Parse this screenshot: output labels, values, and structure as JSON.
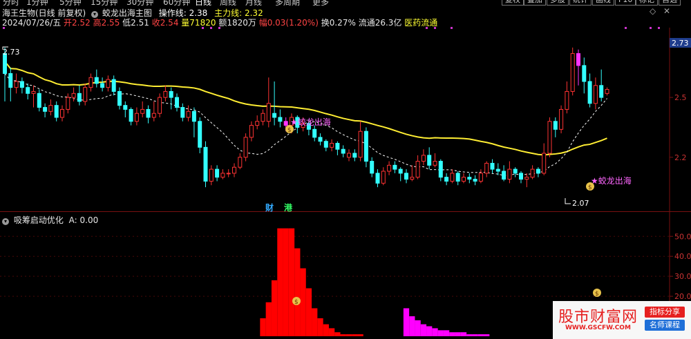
{
  "toolbar": {
    "periods": [
      "分时",
      "1分钟",
      "5分钟",
      "15分钟",
      "30分钟",
      "60分钟",
      "日线",
      "周线",
      "月线",
      "多周期",
      "更多"
    ],
    "active_period": "日线",
    "right_tabs": [
      "复权",
      "叠加",
      "多股",
      "统计",
      "画线",
      "F10",
      "标记",
      "自选"
    ],
    "diamond": "◇",
    "close": "✕"
  },
  "header": {
    "stock": "海王生物(日线 前复权)",
    "chart_name": "蛟龙出海主图",
    "op_label": "操作线:",
    "op_value": "2.38",
    "main_label": "主力线:",
    "main_value": "2.32"
  },
  "quote": {
    "date": "2024/07/26/五",
    "open": "开2.52",
    "high": "高2.55",
    "low": "低2.51",
    "close": "收2.54",
    "volume": "量71820",
    "amount": "额1820万",
    "change": "幅0.03(1.20%)",
    "turnover": "换0.27%",
    "float_cap": "流通26.3亿",
    "sector": "医药流通"
  },
  "indicator": {
    "name": "吸筹启动优化",
    "value": "A: 0.00"
  },
  "chart_data": [
    {
      "type": "candlestick",
      "name": "main",
      "current_price_tag": "2.73",
      "y_ticks": [
        2.5,
        2.2
      ],
      "ylim": [
        1.95,
        2.85
      ],
      "candles": [
        [
          2.62,
          2.72,
          2.75,
          2.48
        ],
        [
          2.55,
          2.62,
          2.65,
          2.48
        ],
        [
          2.58,
          2.55,
          2.62,
          2.52
        ],
        [
          2.55,
          2.58,
          2.6,
          2.52
        ],
        [
          2.52,
          2.55,
          2.57,
          2.49
        ],
        [
          2.53,
          2.52,
          2.56,
          2.45
        ],
        [
          2.45,
          2.52,
          2.54,
          2.43
        ],
        [
          2.43,
          2.45,
          2.47,
          2.4
        ],
        [
          2.46,
          2.43,
          2.49,
          2.41
        ],
        [
          2.4,
          2.46,
          2.48,
          2.38
        ],
        [
          2.44,
          2.4,
          2.46,
          2.38
        ],
        [
          2.5,
          2.44,
          2.52,
          2.42
        ],
        [
          2.52,
          2.5,
          2.55,
          2.48
        ],
        [
          2.48,
          2.52,
          2.56,
          2.46
        ],
        [
          2.55,
          2.48,
          2.57,
          2.46
        ],
        [
          2.6,
          2.55,
          2.62,
          2.53
        ],
        [
          2.57,
          2.6,
          2.64,
          2.55
        ],
        [
          2.55,
          2.57,
          2.6,
          2.53
        ],
        [
          2.59,
          2.55,
          2.61,
          2.53
        ],
        [
          2.53,
          2.59,
          2.61,
          2.51
        ],
        [
          2.46,
          2.53,
          2.55,
          2.44
        ],
        [
          2.44,
          2.46,
          2.48,
          2.4
        ],
        [
          2.38,
          2.44,
          2.45,
          2.36
        ],
        [
          2.42,
          2.38,
          2.45,
          2.36
        ],
        [
          2.44,
          2.42,
          2.48,
          2.4
        ],
        [
          2.4,
          2.44,
          2.46,
          2.37
        ],
        [
          2.42,
          2.4,
          2.48,
          2.38
        ],
        [
          2.5,
          2.42,
          2.52,
          2.4
        ],
        [
          2.53,
          2.5,
          2.56,
          2.48
        ],
        [
          2.5,
          2.53,
          2.55,
          2.44
        ],
        [
          2.45,
          2.5,
          2.52,
          2.43
        ],
        [
          2.4,
          2.45,
          2.47,
          2.38
        ],
        [
          2.43,
          2.4,
          2.46,
          2.38
        ],
        [
          2.38,
          2.43,
          2.45,
          2.3
        ],
        [
          2.25,
          2.38,
          2.4,
          2.22
        ],
        [
          2.08,
          2.25,
          2.28,
          2.05
        ],
        [
          2.14,
          2.08,
          2.16,
          2.06
        ],
        [
          2.1,
          2.14,
          2.16,
          2.08
        ],
        [
          2.12,
          2.1,
          2.14,
          2.09
        ],
        [
          2.12,
          2.12,
          2.14,
          2.1
        ],
        [
          2.15,
          2.12,
          2.17,
          2.1
        ],
        [
          2.2,
          2.15,
          2.22,
          2.14
        ],
        [
          2.3,
          2.2,
          2.32,
          2.18
        ],
        [
          2.36,
          2.3,
          2.38,
          2.28
        ],
        [
          2.38,
          2.36,
          2.41,
          2.34
        ],
        [
          2.42,
          2.38,
          2.44,
          2.36
        ],
        [
          2.47,
          2.38,
          2.6,
          2.35
        ],
        [
          2.4,
          2.42,
          2.58,
          2.36
        ],
        [
          2.38,
          2.4,
          2.44,
          2.35
        ],
        [
          2.36,
          2.38,
          2.4,
          2.33
        ],
        [
          2.4,
          2.36,
          2.42,
          2.32
        ],
        [
          2.35,
          2.4,
          2.41,
          2.32
        ],
        [
          2.37,
          2.35,
          2.4,
          2.33
        ],
        [
          2.34,
          2.37,
          2.39,
          2.31
        ],
        [
          2.3,
          2.34,
          2.36,
          2.28
        ],
        [
          2.28,
          2.3,
          2.32,
          2.26
        ],
        [
          2.25,
          2.28,
          2.29,
          2.23
        ],
        [
          2.27,
          2.25,
          2.29,
          2.23
        ],
        [
          2.24,
          2.27,
          2.28,
          2.21
        ],
        [
          2.22,
          2.24,
          2.26,
          2.2
        ],
        [
          2.22,
          2.2,
          2.24,
          2.18
        ],
        [
          2.2,
          2.22,
          2.24,
          2.18
        ],
        [
          2.33,
          2.2,
          2.38,
          2.18
        ],
        [
          2.18,
          2.33,
          2.35,
          2.15
        ],
        [
          2.12,
          2.18,
          2.2,
          2.1
        ],
        [
          2.07,
          2.12,
          2.14,
          2.05
        ],
        [
          2.13,
          2.07,
          2.15,
          2.06
        ],
        [
          2.16,
          2.13,
          2.18,
          2.11
        ],
        [
          2.14,
          2.16,
          2.18,
          2.12
        ],
        [
          2.12,
          2.14,
          2.15,
          2.08
        ],
        [
          2.09,
          2.12,
          2.14,
          2.07
        ],
        [
          2.1,
          2.09,
          2.16,
          2.08
        ],
        [
          2.18,
          2.1,
          2.21,
          2.09
        ],
        [
          2.21,
          2.18,
          2.24,
          2.16
        ],
        [
          2.16,
          2.21,
          2.25,
          2.14
        ],
        [
          2.18,
          2.16,
          2.22,
          2.15
        ],
        [
          2.1,
          2.18,
          2.19,
          2.08
        ],
        [
          2.08,
          2.1,
          2.12,
          2.06
        ],
        [
          2.12,
          2.08,
          2.14,
          2.07
        ],
        [
          2.08,
          2.12,
          2.13,
          2.06
        ],
        [
          2.1,
          2.08,
          2.12,
          2.07
        ],
        [
          2.09,
          2.1,
          2.12,
          2.07
        ],
        [
          2.08,
          2.09,
          2.11,
          2.06
        ],
        [
          2.12,
          2.08,
          2.14,
          2.07
        ],
        [
          2.17,
          2.12,
          2.18,
          2.1
        ],
        [
          2.14,
          2.17,
          2.19,
          2.12
        ],
        [
          2.13,
          2.14,
          2.17,
          2.11
        ],
        [
          2.09,
          2.13,
          2.16,
          2.08
        ],
        [
          2.14,
          2.09,
          2.18,
          2.07
        ],
        [
          2.12,
          2.14,
          2.15,
          2.1
        ],
        [
          2.09,
          2.12,
          2.13,
          2.07
        ],
        [
          2.1,
          2.09,
          2.12,
          2.05
        ],
        [
          2.14,
          2.1,
          2.16,
          2.09
        ],
        [
          2.12,
          2.14,
          2.15,
          2.1
        ],
        [
          2.22,
          2.12,
          2.27,
          2.11
        ],
        [
          2.38,
          2.22,
          2.4,
          2.2
        ],
        [
          2.34,
          2.38,
          2.4,
          2.3
        ],
        [
          2.44,
          2.34,
          2.46,
          2.32
        ],
        [
          2.53,
          2.44,
          2.58,
          2.42
        ],
        [
          2.72,
          2.53,
          2.75,
          2.51
        ],
        [
          2.66,
          2.72,
          2.74,
          2.56
        ],
        [
          2.58,
          2.66,
          2.7,
          2.52
        ],
        [
          2.47,
          2.58,
          2.62,
          2.45
        ],
        [
          2.56,
          2.47,
          2.6,
          2.44
        ],
        [
          2.5,
          2.56,
          2.64,
          2.48
        ],
        [
          2.54,
          2.52,
          2.55,
          2.51
        ]
      ],
      "annotations": {
        "high_label": "2.73",
        "low_label": "2.07",
        "signals": [
          "★蛟龙出海",
          "★蛟龙出海"
        ],
        "event_tags": [
          "财",
          "港"
        ],
        "money_icon": "$"
      }
    },
    {
      "type": "bar",
      "name": "吸筹启动优化",
      "y_ticks": [
        50.0,
        40.0,
        30.0,
        20.0
      ],
      "ylim": [
        0,
        57
      ],
      "series": [
        {
          "color": "#ff0000",
          "x_start": 45,
          "values": [
            9,
            17,
            28,
            54,
            54,
            54,
            44,
            34,
            24,
            14,
            9,
            6,
            4,
            2,
            1,
            1,
            1,
            1
          ]
        },
        {
          "color": "#ff00ff",
          "x_start": 70,
          "values": [
            14,
            10,
            8,
            6,
            5,
            4,
            3,
            3,
            2,
            2,
            2,
            1,
            1,
            1,
            1
          ]
        },
        {
          "color": "#ff0000",
          "x_start": 102,
          "values": [
            12,
            12,
            6,
            4,
            3,
            2,
            1,
            1,
            1,
            1
          ]
        },
        {
          "color": "#ff00ff",
          "x_start": 144,
          "values": [
            14,
            17,
            33,
            36,
            37,
            37,
            6
          ]
        }
      ]
    }
  ],
  "watermark": {
    "name": "股市财富网",
    "url": "WWW.GSCFW.COM",
    "tag1": "指标分享",
    "tag2": "名师课程"
  }
}
